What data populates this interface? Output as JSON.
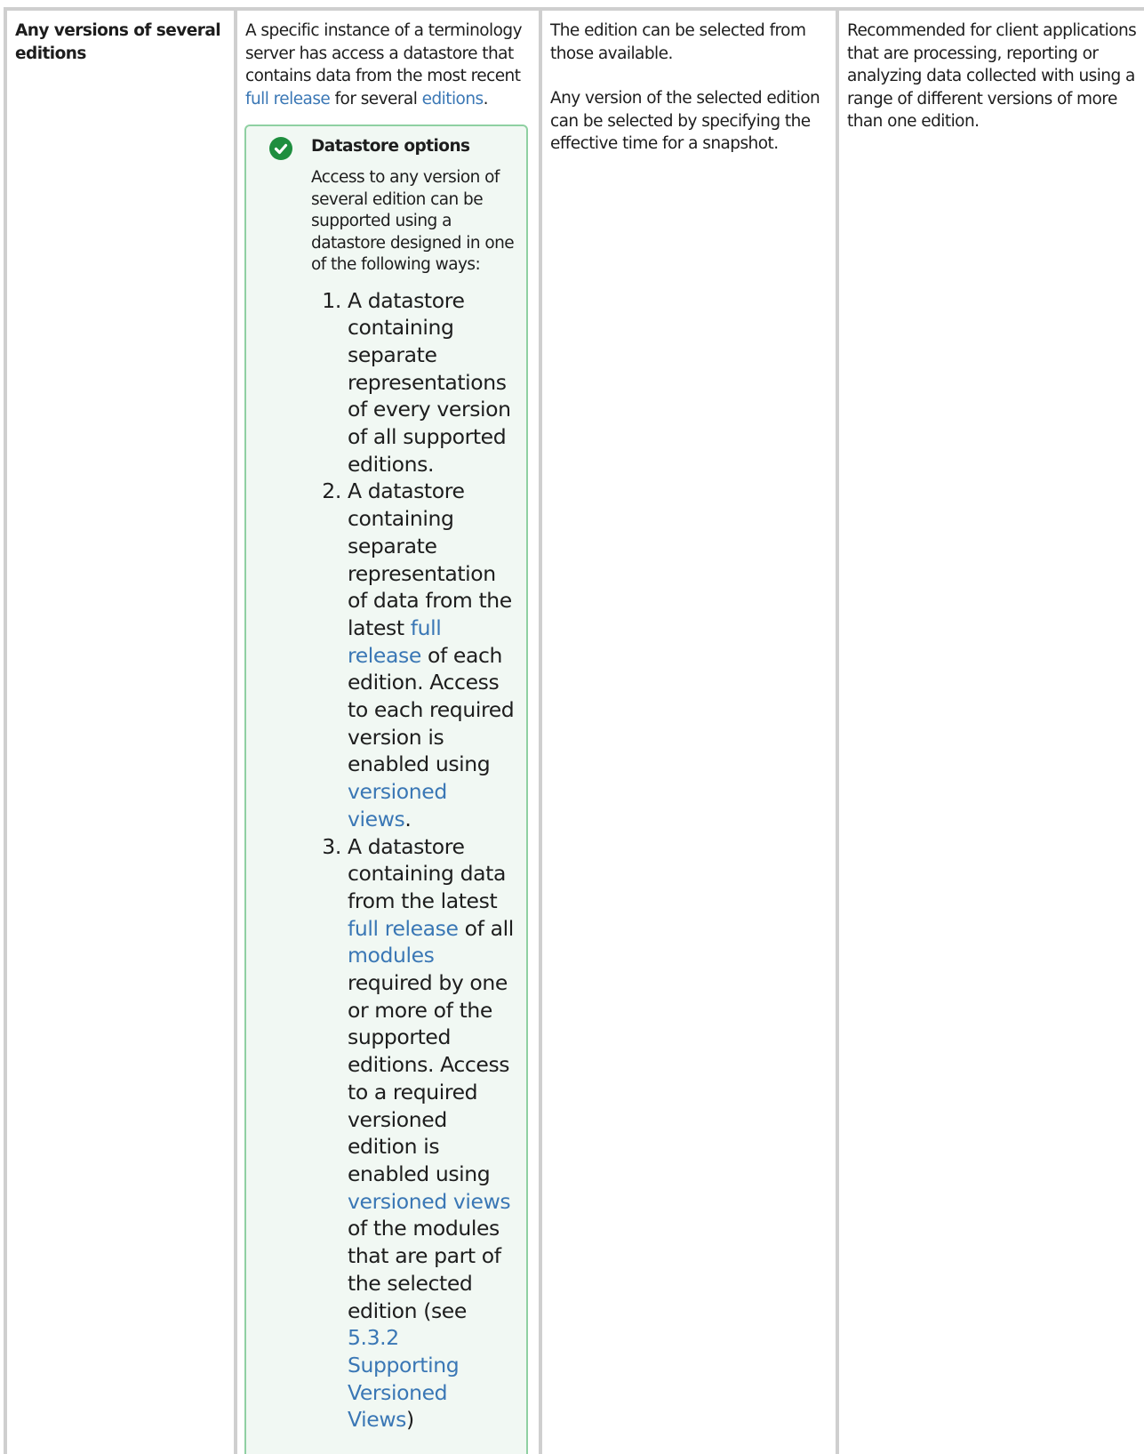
{
  "row": {
    "col1": {
      "label": "Any versions of several editions"
    },
    "col2": {
      "intro_before_link1": "A specific instance of a terminology server has access a datastore that contains data from the most recent ",
      "link1": "full release",
      "intro_between": " for several ",
      "link2": "editions",
      "intro_end": ".",
      "callout": {
        "icon": "check-circle-icon",
        "title": "Datastore options",
        "text": "Access to any version of several edition can be supported using a datastore designed in one of the following ways:",
        "items": [
          {
            "text_a": "A datastore containing separate representations of every version of all supported editions."
          },
          {
            "text_a": "A datastore containing separate representation of data from the latest ",
            "link_a": "full release",
            "text_b": " of each edition. Access to each required version is enabled using ",
            "link_b": "versioned views",
            "text_c": "."
          },
          {
            "text_a": "A datastore containing data from the latest ",
            "link_a": "full release",
            "text_b": " of all ",
            "link_b": "modules",
            "text_c": " required by one or more of the supported editions. Access to a required versioned edition is enabled using ",
            "link_c": "versioned views",
            "text_d": " of the modules that are part of the selected edition (see ",
            "link_d": "5.3.2 Supporting Versioned Views",
            "text_e": ")"
          }
        ]
      }
    },
    "col3": {
      "para1": "The edition can be selected from those available.",
      "para2": "Any version of the selected edition can be selected by specifying the effective time for a snapshot."
    },
    "col4": {
      "text": "Recommended for client applications that are processing, reporting or analyzing data collected with using a range of different versions of more than one edition."
    }
  },
  "colors": {
    "link": "#3a77b5",
    "callout_border": "#8fd0a2",
    "callout_background": "#f1f8f3",
    "check_icon": "#1e8e3e",
    "table_border": "#cfcfcf"
  }
}
